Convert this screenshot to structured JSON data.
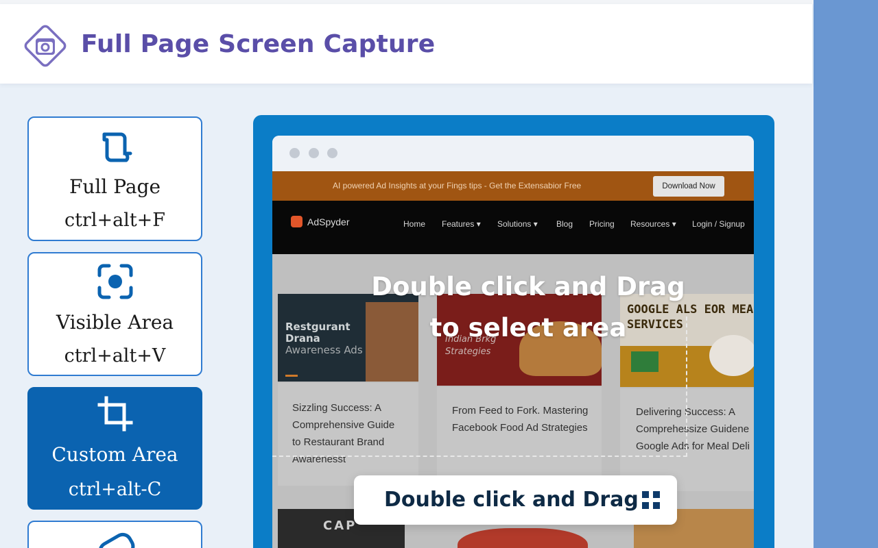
{
  "app": {
    "title": "Full Page Screen Capture"
  },
  "capture_modes": [
    {
      "label": "Full Page",
      "shortcut": "ctrl+alt+F",
      "icon": "full-page-icon",
      "active": false
    },
    {
      "label": "Visible Area",
      "shortcut": "ctrl+alt+V",
      "icon": "visible-area-icon",
      "active": false
    },
    {
      "label": "Custom Area",
      "shortcut": "ctrl+alt-C",
      "icon": "crop-icon",
      "active": true
    }
  ],
  "preview": {
    "promo_text": "AI powered Ad Insights at your Fings tips - Get the Extensabior Free",
    "promo_button": "Download Now",
    "brand": "AdSpyder",
    "nav": [
      "Home",
      "Features ▾",
      "Solutions ▾",
      "Blog",
      "Pricing",
      "Resources ▾",
      "Login / Signup"
    ],
    "thumbs": [
      {
        "line1": "Restgurant",
        "line2": "Drana",
        "line3": "Awareness Ads"
      },
      {
        "line1": "Indian Brkg",
        "line2": "Strategies"
      },
      {
        "line1": "GOOGLE ALS EOR MEAL DEL",
        "line2": "SERVICES"
      }
    ],
    "articles": [
      [
        "Sizzling Success: A",
        "Comprehensive Guide",
        "to Restaurant Brand",
        "Awarenesst"
      ],
      [
        "From Feed to Fork. Mastering",
        "Facebook Food Ad Strategies"
      ],
      [
        "Delivering Success: A",
        "Comprehessize Guidene",
        "Google Ads for Meal Deli"
      ]
    ],
    "bottom_thumb_text": "CAP"
  },
  "overlay": {
    "line1": "Double click and Drag",
    "line2": "to select area"
  },
  "hint": {
    "text": "Double click and Drag"
  },
  "colors": {
    "accent": "#0b63b0",
    "title": "#5a4ea8",
    "frame": "#0b7dc7"
  }
}
